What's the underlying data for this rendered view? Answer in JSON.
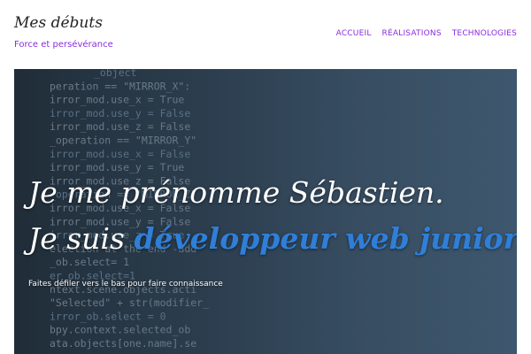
{
  "header": {
    "site_title": "Mes débuts",
    "tagline": "Force et persévérance",
    "nav": [
      "ACCUEIL",
      "RÉALISATIONS",
      "TECHNOLOGIES"
    ]
  },
  "hero": {
    "line1": "Je me prénomme Sébastien.",
    "line2_prefix": "Je suis",
    "line2_typed": "développeur web junior.",
    "cursor": "|",
    "subtitle": "Faites défiler vers le bas pour faire connaissance",
    "code_lines": [
      "_object",
      "peration == \"MIRROR_X\":",
      "irror_mod.use_x = True",
      "irror_mod.use_y = False",
      "irror_mod.use_z = False",
      "_operation == \"MIRROR_Y\"",
      "irror_mod.use_x = False",
      "irror_mod.use_y = True",
      "irror_mod.use_z = False",
      "_operation == \"MIRROR_Z\"",
      "irror_mod.use_x = False",
      "irror_mod.use_y = False",
      "irror_mod.use_z = True",
      "election at the end -add",
      "_ob.select= 1",
      "er_ob.select=1",
      "ntext.scene.objects.acti",
      "\"Selected\" + str(modifier_",
      "irror_ob.select = 0",
      "bpy.context.selected_ob",
      "ata.objects[one.name].se"
    ]
  },
  "colors": {
    "accent": "#8a2be2",
    "typed_text": "#2f7fd8",
    "hero_text": "#ffffff"
  }
}
